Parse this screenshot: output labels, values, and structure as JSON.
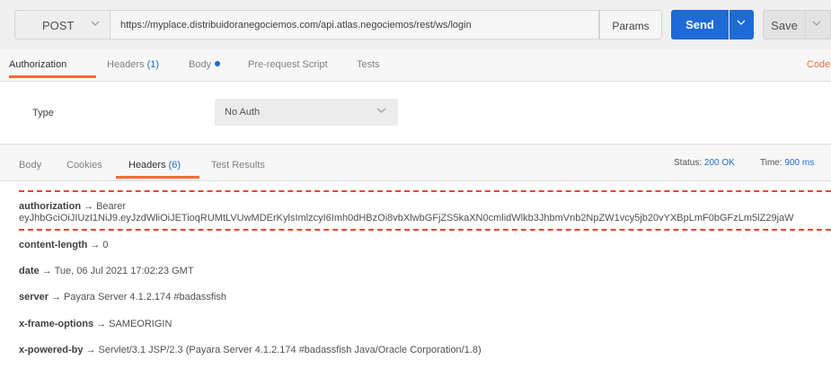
{
  "request": {
    "method": "POST",
    "url": "https://myplace.distribuidoranegociemos.com/api.atlas.negociemos/rest/ws/login",
    "params_label": "Params",
    "send_label": "Send",
    "save_label": "Save"
  },
  "request_tabs": {
    "authorization": "Authorization",
    "headers": "Headers",
    "headers_count": "(1)",
    "body": "Body",
    "pre_request": "Pre-request Script",
    "tests": "Tests",
    "code": "Code"
  },
  "auth": {
    "type_label": "Type",
    "type_value": "No Auth"
  },
  "response_tabs": {
    "body": "Body",
    "cookies": "Cookies",
    "headers": "Headers",
    "headers_count": "(6)",
    "test_results": "Test Results"
  },
  "response_status": {
    "status_label": "Status:",
    "status_value": "200 OK",
    "time_label": "Time:",
    "time_value": "900 ms"
  },
  "arrow": "→",
  "response_headers": [
    {
      "name": "authorization",
      "value": "Bearer",
      "value_cont": "eyJhbGciOiJIUzI1NiJ9.eyJzdWliOiJETioqRUMtLVUwMDErKylsImlzcyI6Imh0dHBzOi8vbXlwbGFjZS5kaXN0cmlidWlkb3JhbmVnb2NpZW1vcy5jb20vYXBpLmF0bGFzLm5lZ29jaW"
    },
    {
      "name": "content-length",
      "value": "0"
    },
    {
      "name": "date",
      "value": "Tue, 06 Jul 2021 17:02:23 GMT"
    },
    {
      "name": "server",
      "value": "Payara Server 4.1.2.174 #badassfish"
    },
    {
      "name": "x-frame-options",
      "value": "SAMEORIGIN"
    },
    {
      "name": "x-powered-by",
      "value": "Servlet/3.1 JSP/2.3 (Payara Server 4.1.2.174 #badassfish Java/Oracle Corporation/1.8)"
    }
  ],
  "colors": {
    "accent": "#f26b3a",
    "primary": "#1e6ad6",
    "annotation": "#e8452c"
  }
}
